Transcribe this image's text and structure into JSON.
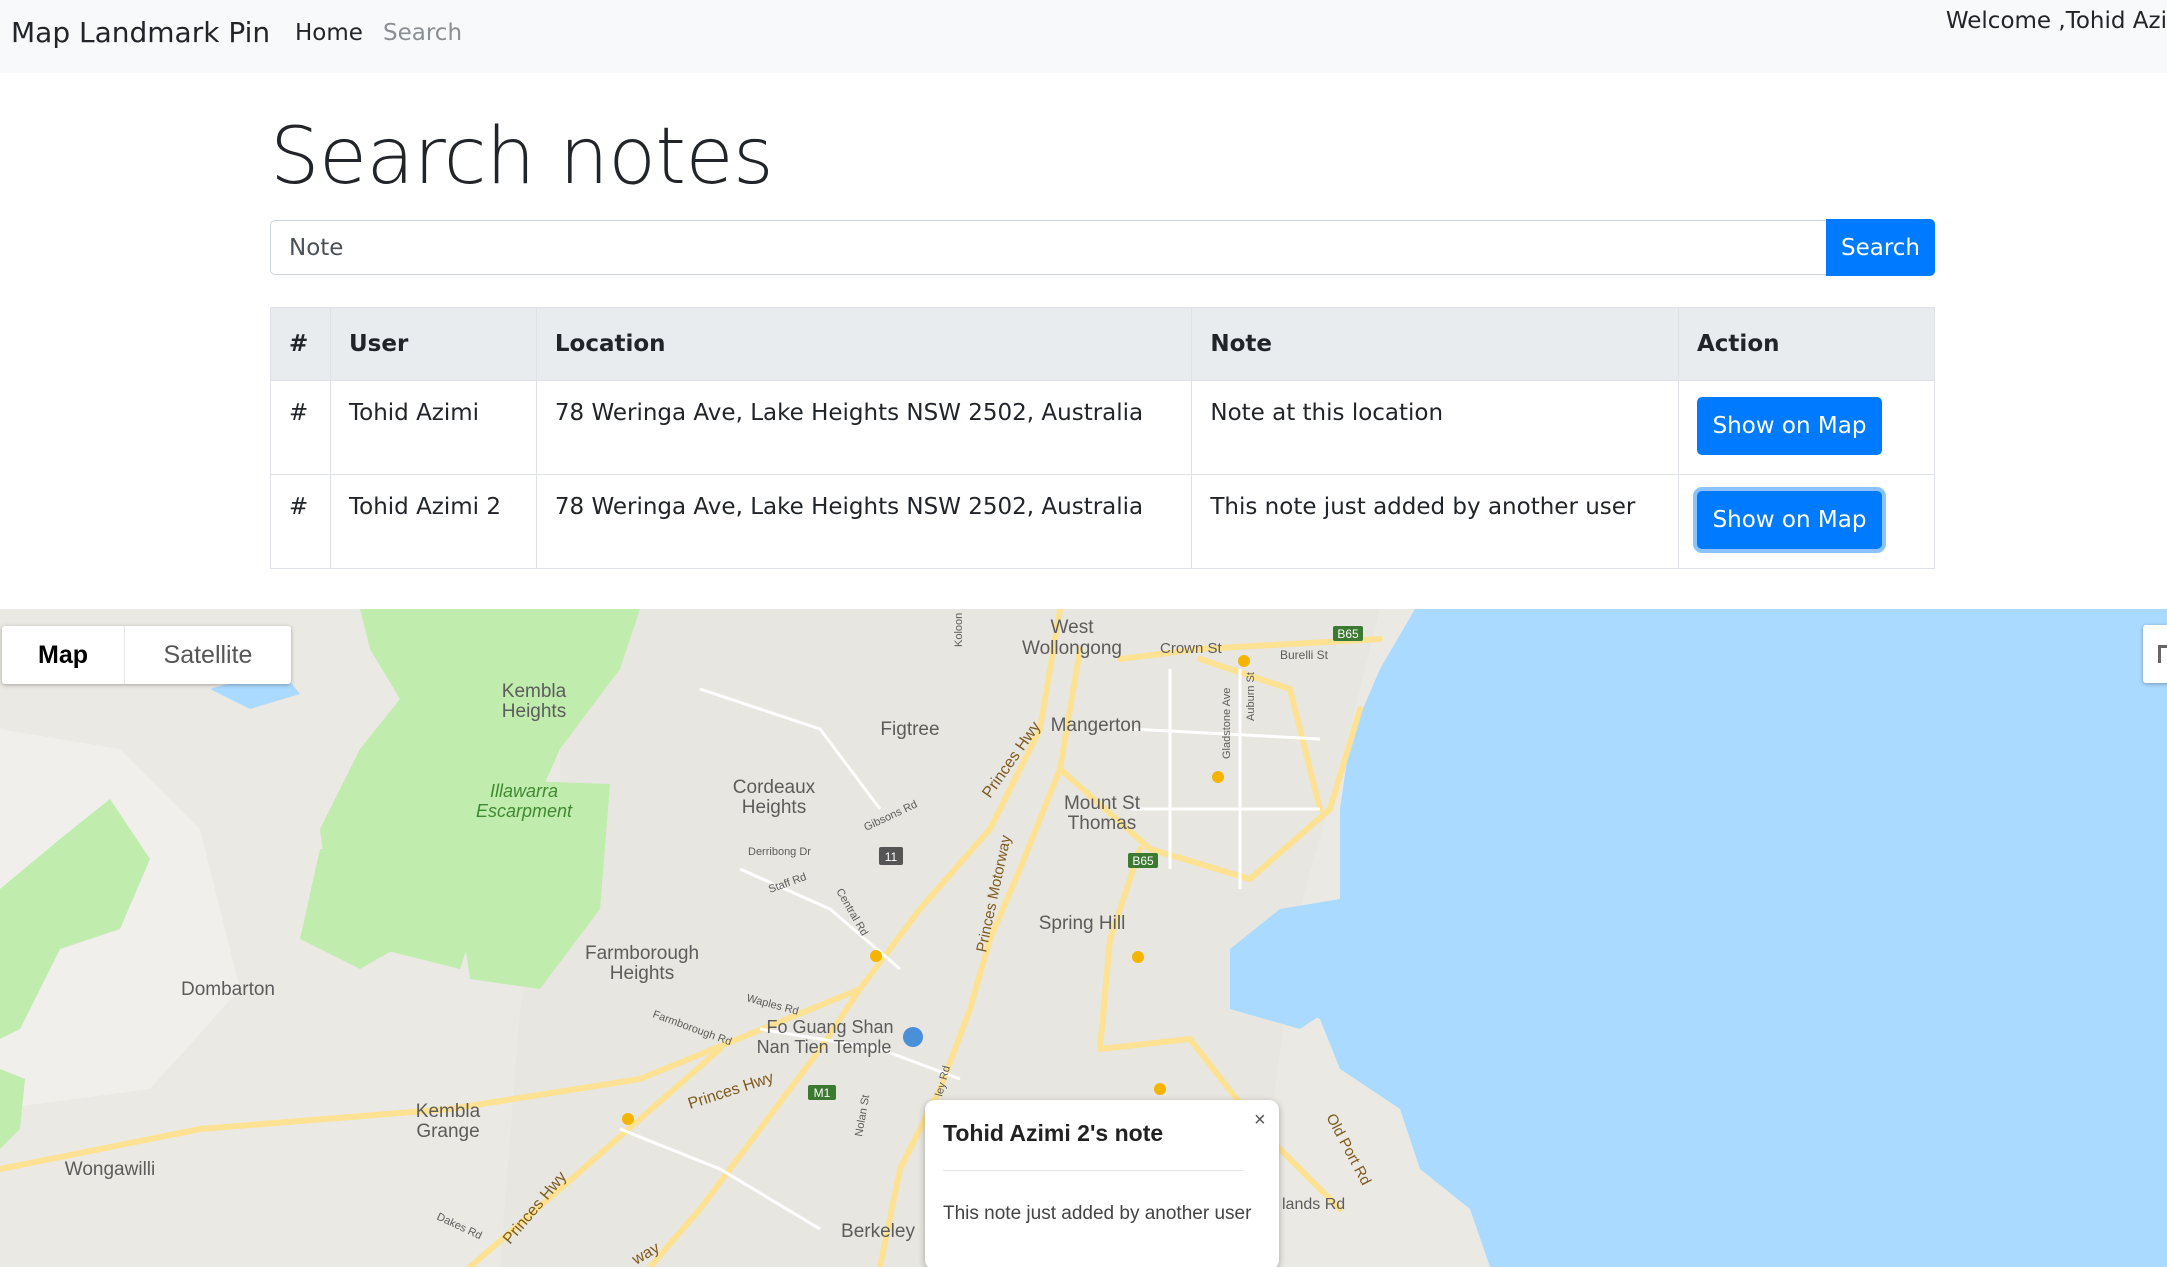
{
  "navbar": {
    "brand": "Map Landmark Pin",
    "links": [
      {
        "label": "Home"
      },
      {
        "label": "Search"
      }
    ],
    "welcome": "Welcome ,Tohid Azi"
  },
  "page": {
    "title": "Search notes",
    "search": {
      "value": "Note",
      "button_label": "Search"
    }
  },
  "table": {
    "headers": [
      "#",
      "User",
      "Location",
      "Note",
      "Action"
    ],
    "rows": [
      {
        "num": "#",
        "user": "Tohid Azimi",
        "location": "78 Weringa Ave, Lake Heights NSW 2502, Australia",
        "note": "Note at this location",
        "action": "Show on Map"
      },
      {
        "num": "#",
        "user": "Tohid Azimi 2",
        "location": "78 Weringa Ave, Lake Heights NSW 2502, Australia",
        "note": "This note just added by another user",
        "action": "Show on Map"
      }
    ]
  },
  "map": {
    "type_buttons": {
      "map": "Map",
      "satellite": "Satellite"
    },
    "labels": {
      "west_wollongong": [
        "West",
        "Wollongong"
      ],
      "crown_st": "Crown St",
      "burelli_st": "Burelli St",
      "b65_top": "B65",
      "b65_mid": "B65",
      "m1": "M1",
      "route_11": "11",
      "kembla_heights": [
        "Kembla",
        "Heights"
      ],
      "figtree": "Figtree",
      "mangerton": "Mangerton",
      "illawarra": [
        "Illawarra",
        "Escarpment"
      ],
      "cordeaux": [
        "Cordeaux",
        "Heights"
      ],
      "princes_hwy_top": "Princes Hwy",
      "mount_st_thomas": [
        "Mount St",
        "Thomas"
      ],
      "gibsons_rd": "Gibsons Rd",
      "derribong_dr": "Derribong Dr",
      "staff_rd": "Staff Rd",
      "central_rd": "Central Rd",
      "princes_motorway": "Princes Motorway",
      "spring_hill": "Spring Hill",
      "farmborough": [
        "Farmborough",
        "Heights"
      ],
      "dombarton": "Dombarton",
      "waples_rd": "Waples Rd",
      "farmborough_rd": "Farmborough Rd",
      "fo_guang_shan": [
        "Fo Guang Shan",
        "Nan Tien Temple"
      ],
      "kembla_grange": [
        "Kembla",
        "Grange"
      ],
      "princes_hwy_mid": "Princes Hwy",
      "wongawilli": "Wongawilli",
      "princes_hwy_low": "Princes Hwy",
      "berkeley": "Berkeley",
      "old_port_rd": "Old Port Rd",
      "lands_rd": "lands Rd",
      "gladstone_ave": "Gladstone Ave",
      "auburn_st": "Auburn St",
      "kolon": "Koloon",
      "nolan_st": "Nolan St",
      "daiso_rd": "Dakes Rd",
      "way": "way",
      "ley_rd": "ley Rd"
    },
    "colors": {
      "water": "#aadaff",
      "park": "#c0ecae",
      "road": "#fde293",
      "land": "#ebe9e4"
    },
    "info_window": {
      "title": "Tohid Azimi 2's note",
      "body": "This note just added by another user",
      "close_icon": "×"
    }
  }
}
